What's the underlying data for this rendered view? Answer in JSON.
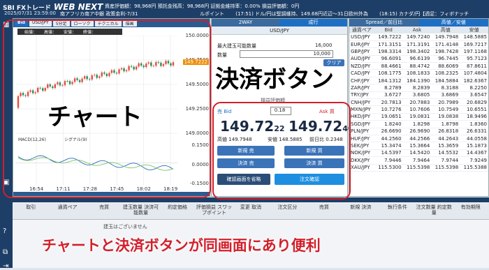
{
  "header": {
    "logo_brand": "SBI FXトレード",
    "logo_name": "WEB NEXT",
    "datetime": "2025/07/31 23:59:00",
    "announce": "南アフリカ南ア中銀 政策金利-7/31",
    "assets": "資産評価額：98,968円  預託金残高：98,968円  証拠金維持率：0.00%  損益評価額：0円",
    "clock_items": [
      "ルポイント",
      "(17:51) ドル/円は堅調維持、149.68円近辺〜31日欧州外為",
      "(18:15) カナダ/円【週足：フィボナッチ"
    ]
  },
  "chart": {
    "tabs": [
      "Bid",
      "USD/JPY",
      "5分足",
      "ローソク",
      "テクニカル",
      "描画"
    ],
    "ohlc_labels": [
      "始値：",
      "高値：",
      "安値：",
      "終値："
    ],
    "macd_label": "MACD(12,26)",
    "signal_label": "シグナル(9)",
    "y_ticks": [
      "150.0000",
      "149.7500",
      "149.5000",
      "149.2500",
      "149.0000",
      "0.1500",
      "0.0000",
      "-0.1500"
    ],
    "current_price": "149.7222",
    "x_ticks": [
      "16:54",
      "17:11",
      "17:28",
      "17:45",
      "18:02",
      "18:19"
    ]
  },
  "chart_data": {
    "type": "line",
    "title": "",
    "xlabel": "",
    "ylabel": "",
    "x": [
      "16:54",
      "17:11",
      "17:28",
      "17:45",
      "18:02",
      "18:19"
    ],
    "series": [
      {
        "name": "USD/JPY Bid",
        "values": [
          149.38,
          149.48,
          149.55,
          149.62,
          149.7,
          149.72
        ]
      }
    ],
    "ylim": [
      149.0,
      150.0
    ]
  },
  "trade": {
    "tabs": [
      "2WAY",
      "成行"
    ],
    "pair": "USD/JPY",
    "max_qty_label": "最大建玉可能数量",
    "max_qty_value": "16,000",
    "qty_label": "数量",
    "qty_value": "10,000",
    "qty_unit": "通貨",
    "clear": "クリア",
    "slip_label": "損益評価額",
    "sell_label": "売 Bid",
    "spread": "0.18",
    "buy_label": "Ask 買",
    "bid_big": "149.72",
    "bid_small": "22",
    "ask_big": "149.72",
    "ask_small": "40",
    "high_label": "高値",
    "high": "149.7948",
    "low_label": "安値",
    "low": "148.5885",
    "change_label": "前日比",
    "change": "0.2348",
    "new_sell": "新規 売",
    "new_buy": "新規 買",
    "settle_sell": "決済 売",
    "settle_buy": "決済 買",
    "skip_confirm": "確認画面を省略",
    "order_confirm": "注文確認"
  },
  "rates": {
    "tabs": [
      "Spread／前日比",
      "高値／安値"
    ],
    "headers": [
      "通貨ペア",
      "Bid",
      "Ask",
      "高値",
      "安値"
    ],
    "rows": [
      [
        "USD/JPY",
        "149.7222",
        "149.7240",
        "149.7948",
        "148.5885"
      ],
      [
        "EUR/JPY",
        "171.3151",
        "171.3191",
        "171.4148",
        "169.7217"
      ],
      [
        "GBP/JPY",
        "198.3314",
        "198.3402",
        "198.7428",
        "197.1168"
      ],
      [
        "AUD/JPY",
        "96.6091",
        "96.6139",
        "96.7445",
        "95.7123"
      ],
      [
        "NZD/JPY",
        "88.4661",
        "88.4742",
        "88.6069",
        "87.8611"
      ],
      [
        "CAD/JPY",
        "108.1775",
        "108.1833",
        "108.2325",
        "107.4804"
      ],
      [
        "CHF/JPY",
        "184.1312",
        "184.1390",
        "184.5884",
        "182.6367"
      ],
      [
        "ZAR/JPY",
        "8.2789",
        "8.2839",
        "8.3188",
        "8.2250"
      ],
      [
        "TRY/JPY",
        "3.6727",
        "3.6805",
        "3.6869",
        "3.6547"
      ],
      [
        "CNH/JPY",
        "20.7813",
        "20.7883",
        "20.7989",
        "20.6829"
      ],
      [
        "MXN/JPY",
        "10.7276",
        "10.7606",
        "10.7549",
        "10.6551"
      ],
      [
        "HKD/JPY",
        "19.0651",
        "19.0831",
        "19.0838",
        "18.9496"
      ],
      [
        "SGD/JPY",
        "1.8240",
        "1.8298",
        "1.8798",
        "1.8360"
      ],
      [
        "PLN/JPY",
        "26.6690",
        "26.9690",
        "26.8318",
        "26.6331"
      ],
      [
        "HUF/JPY",
        "44.2560",
        "44.2566",
        "44.2643",
        "44.0558"
      ],
      [
        "SEK/JPY",
        "15.3474",
        "15.3664",
        "15.3659",
        "15.1873"
      ],
      [
        "NOK/JPY",
        "14.5397",
        "14.5420",
        "14.5532",
        "14.4367"
      ],
      [
        "DKK/JPY",
        "7.9446",
        "7.9464",
        "7.9744",
        "7.9249"
      ],
      [
        "XAU/JPY",
        "115.5300",
        "115.5398",
        "115.5398",
        "115.5388"
      ]
    ]
  },
  "orders": {
    "columns": [
      "取引",
      "通貨ペア",
      "売買",
      "建玉数量\n決済可能数量",
      "約定価格",
      "評価損益\nスワップポイント",
      "変更\n取消",
      "注文区分",
      "売買",
      "新規\n決済",
      "執行条件",
      "注文数量\n約定数量",
      "有効期限"
    ],
    "empty_msg": "建玉はございません"
  },
  "annotations": {
    "chart_callout": "チャート",
    "order_callout": "決済ボタン",
    "banner": "チャートと決済ボタンが同画面にあり便利"
  }
}
